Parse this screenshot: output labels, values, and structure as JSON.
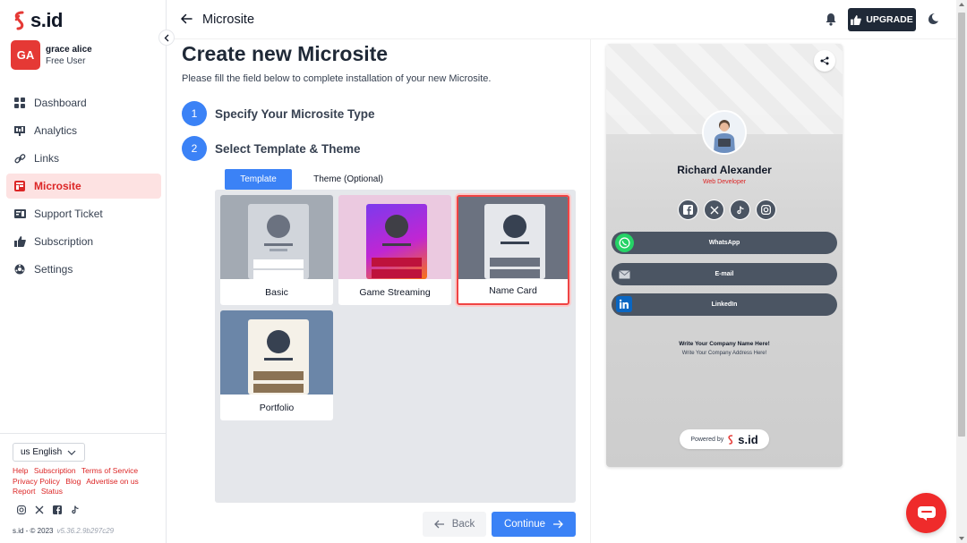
{
  "brand": {
    "name": "s.id",
    "accent": "#e53935"
  },
  "user": {
    "initials": "GA",
    "name": "grace alice",
    "role": "Free User"
  },
  "nav": {
    "items": [
      {
        "label": "Dashboard",
        "icon": "dashboard-icon"
      },
      {
        "label": "Analytics",
        "icon": "analytics-icon"
      },
      {
        "label": "Links",
        "icon": "link-icon"
      },
      {
        "label": "Microsite",
        "icon": "microsite-icon",
        "active": true
      },
      {
        "label": "Support Ticket",
        "icon": "ticket-icon"
      },
      {
        "label": "Subscription",
        "icon": "thumbs-up-icon"
      },
      {
        "label": "Settings",
        "icon": "settings-icon"
      }
    ]
  },
  "footer": {
    "language": "us English",
    "links": [
      "Help",
      "Subscription",
      "Terms of Service",
      "Privacy Policy",
      "Blog",
      "Advertise on us",
      "Report",
      "Status"
    ],
    "copyright": "s.id - © 2023",
    "version": "v5.36.2.9b297c29"
  },
  "topbar": {
    "title": "Microsite",
    "upgrade_label": "UPGRADE"
  },
  "form": {
    "heading": "Create new Microsite",
    "subheading": "Please fill the field below to complete installation of your new Microsite.",
    "steps": [
      {
        "num": "1",
        "label": "Specify Your Microsite Type"
      },
      {
        "num": "2",
        "label": "Select Template & Theme"
      }
    ],
    "tabs": [
      {
        "label": "Template",
        "active": true
      },
      {
        "label": "Theme (Optional)",
        "active": false
      }
    ],
    "templates": [
      {
        "label": "Basic",
        "selected": false
      },
      {
        "label": "Game Streaming",
        "selected": false
      },
      {
        "label": "Name Card",
        "selected": true
      },
      {
        "label": "Portfolio",
        "selected": false
      }
    ],
    "back_label": "Back",
    "continue_label": "Continue"
  },
  "preview": {
    "name": "Richard Alexander",
    "role": "Web Developer",
    "socials": [
      "facebook-icon",
      "x-icon",
      "tiktok-icon",
      "instagram-icon"
    ],
    "links": [
      {
        "label": "WhatsApp",
        "icon": "whatsapp-icon"
      },
      {
        "label": "E-mail",
        "icon": "email-icon"
      },
      {
        "label": "LinkedIn",
        "icon": "linkedin-icon"
      }
    ],
    "company": "Write Your Company Name Here!",
    "address": "Write Your Company Address Here!",
    "powered_by": "Powered by",
    "powered_brand": "s.id"
  }
}
